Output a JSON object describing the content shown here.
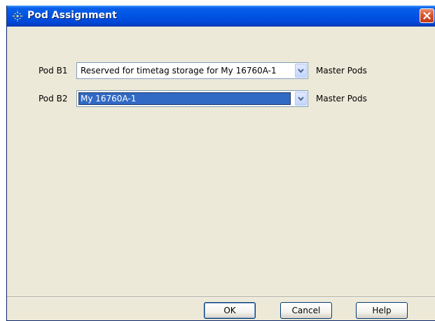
{
  "window": {
    "title": "Pod Assignment",
    "app_icon": "keysight-logo-icon",
    "close_icon": "close-icon"
  },
  "rows": [
    {
      "label": "Pod B1",
      "selected_value": "Reserved for timetag storage for My 16760A-1",
      "highlighted": false,
      "master_label": "Master Pods"
    },
    {
      "label": "Pod B2",
      "selected_value": "My 16760A-1",
      "highlighted": true,
      "master_label": "Master Pods"
    }
  ],
  "buttons": {
    "ok": "OK",
    "cancel": "Cancel",
    "help": "Help"
  },
  "colors": {
    "titlebar": "#0055e5",
    "dialog_bg": "#ece9d8",
    "selection": "#316ac5",
    "close_button": "#d9552b"
  }
}
